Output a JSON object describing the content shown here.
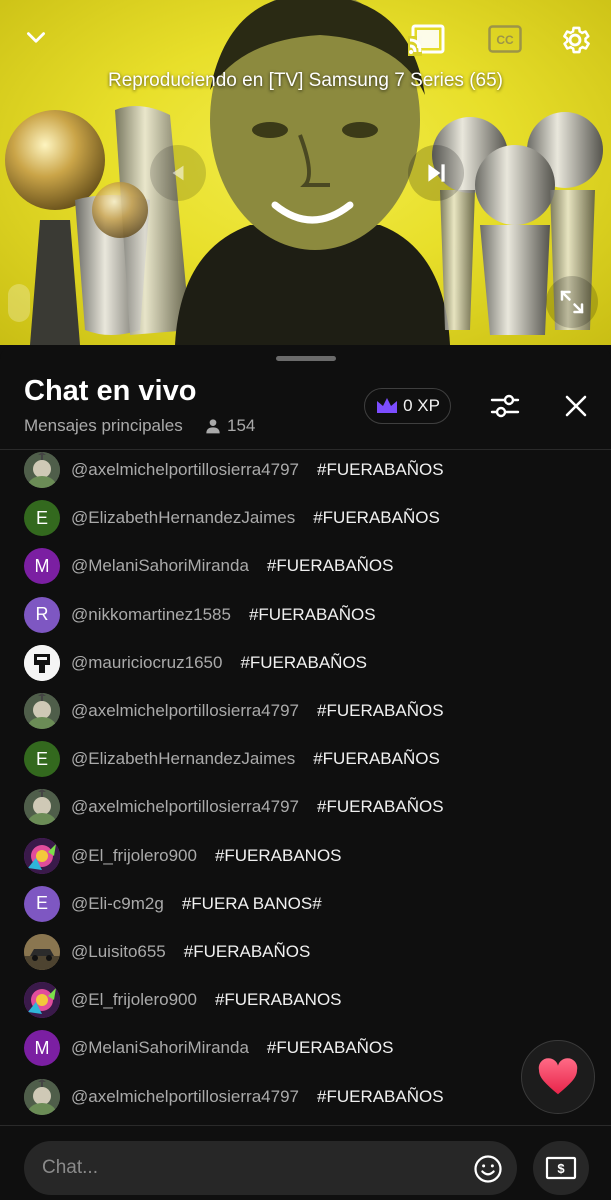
{
  "video": {
    "cast_status": "Reproduciendo en [TV] Samsung 7 Series (65)",
    "icons": [
      "chevron-down-icon",
      "cast-icon",
      "closed-captions-icon",
      "settings-gear-icon",
      "previous-icon",
      "skip-next-icon",
      "fullscreen-icon"
    ]
  },
  "chat": {
    "title": "Chat en vivo",
    "mode": "Mensajes principales",
    "viewer_count": "154",
    "xp": "0 XP",
    "messages": [
      {
        "author": "@axelmichelportillosierra4797",
        "text": "#FUERABAÑOS",
        "avatar": {
          "type": "image",
          "icon": "teletubby-avatar",
          "color": "#5a6a5a"
        }
      },
      {
        "author": "@ElizabethHernandezJaimes",
        "text": "#FUERABAÑOS",
        "avatar": {
          "type": "letter",
          "letter": "E",
          "color": "#33691e"
        }
      },
      {
        "author": "@MelaniSahoriMiranda",
        "text": "#FUERABAÑOS",
        "avatar": {
          "type": "letter",
          "letter": "M",
          "color": "#7b1fa2"
        }
      },
      {
        "author": "@nikkomartinez1585",
        "text": "#FUERABAÑOS",
        "avatar": {
          "type": "letter",
          "letter": "R",
          "color": "#7e57c2"
        }
      },
      {
        "author": "@mauriciocruz1650",
        "text": "#FUERABAÑOS",
        "avatar": {
          "type": "image",
          "icon": "mandalorian-logo-avatar",
          "color": "#f5f5f5"
        }
      },
      {
        "author": "@axelmichelportillosierra4797",
        "text": "#FUERABAÑOS",
        "avatar": {
          "type": "image",
          "icon": "teletubby-avatar",
          "color": "#5a6a5a"
        }
      },
      {
        "author": "@ElizabethHernandezJaimes",
        "text": "#FUERABAÑOS",
        "avatar": {
          "type": "letter",
          "letter": "E",
          "color": "#33691e"
        }
      },
      {
        "author": "@axelmichelportillosierra4797",
        "text": "#FUERABAÑOS",
        "avatar": {
          "type": "image",
          "icon": "teletubby-avatar",
          "color": "#5a6a5a"
        }
      },
      {
        "author": "@El_frijolero900",
        "text": "#FUERABANOS",
        "avatar": {
          "type": "image",
          "icon": "colorful-art-avatar",
          "color": "#8e24aa"
        }
      },
      {
        "author": "@Eli-c9m2g",
        "text": "#FUERA BANOS#",
        "avatar": {
          "type": "letter",
          "letter": "E",
          "color": "#7e57c2"
        }
      },
      {
        "author": "@Luisito655",
        "text": "#FUERABAÑOS",
        "avatar": {
          "type": "image",
          "icon": "car-photo-avatar",
          "color": "#6d5a3a"
        }
      },
      {
        "author": "@El_frijolero900",
        "text": "#FUERABANOS",
        "avatar": {
          "type": "image",
          "icon": "colorful-art-avatar",
          "color": "#8e24aa"
        }
      },
      {
        "author": "@MelaniSahoriMiranda",
        "text": "#FUERABAÑOS",
        "avatar": {
          "type": "letter",
          "letter": "M",
          "color": "#7b1fa2"
        }
      },
      {
        "author": "@axelmichelportillosierra4797",
        "text": "#FUERABAÑOS",
        "avatar": {
          "type": "image",
          "icon": "teletubby-avatar",
          "color": "#5a6a5a"
        }
      }
    ],
    "input_placeholder": "Chat...",
    "colors": {
      "background": "#0f0f0f",
      "author": "#aaaaaa",
      "text": "#f1f1f1",
      "crown": "#7c4dff",
      "heart": "#ff4d6d"
    }
  }
}
